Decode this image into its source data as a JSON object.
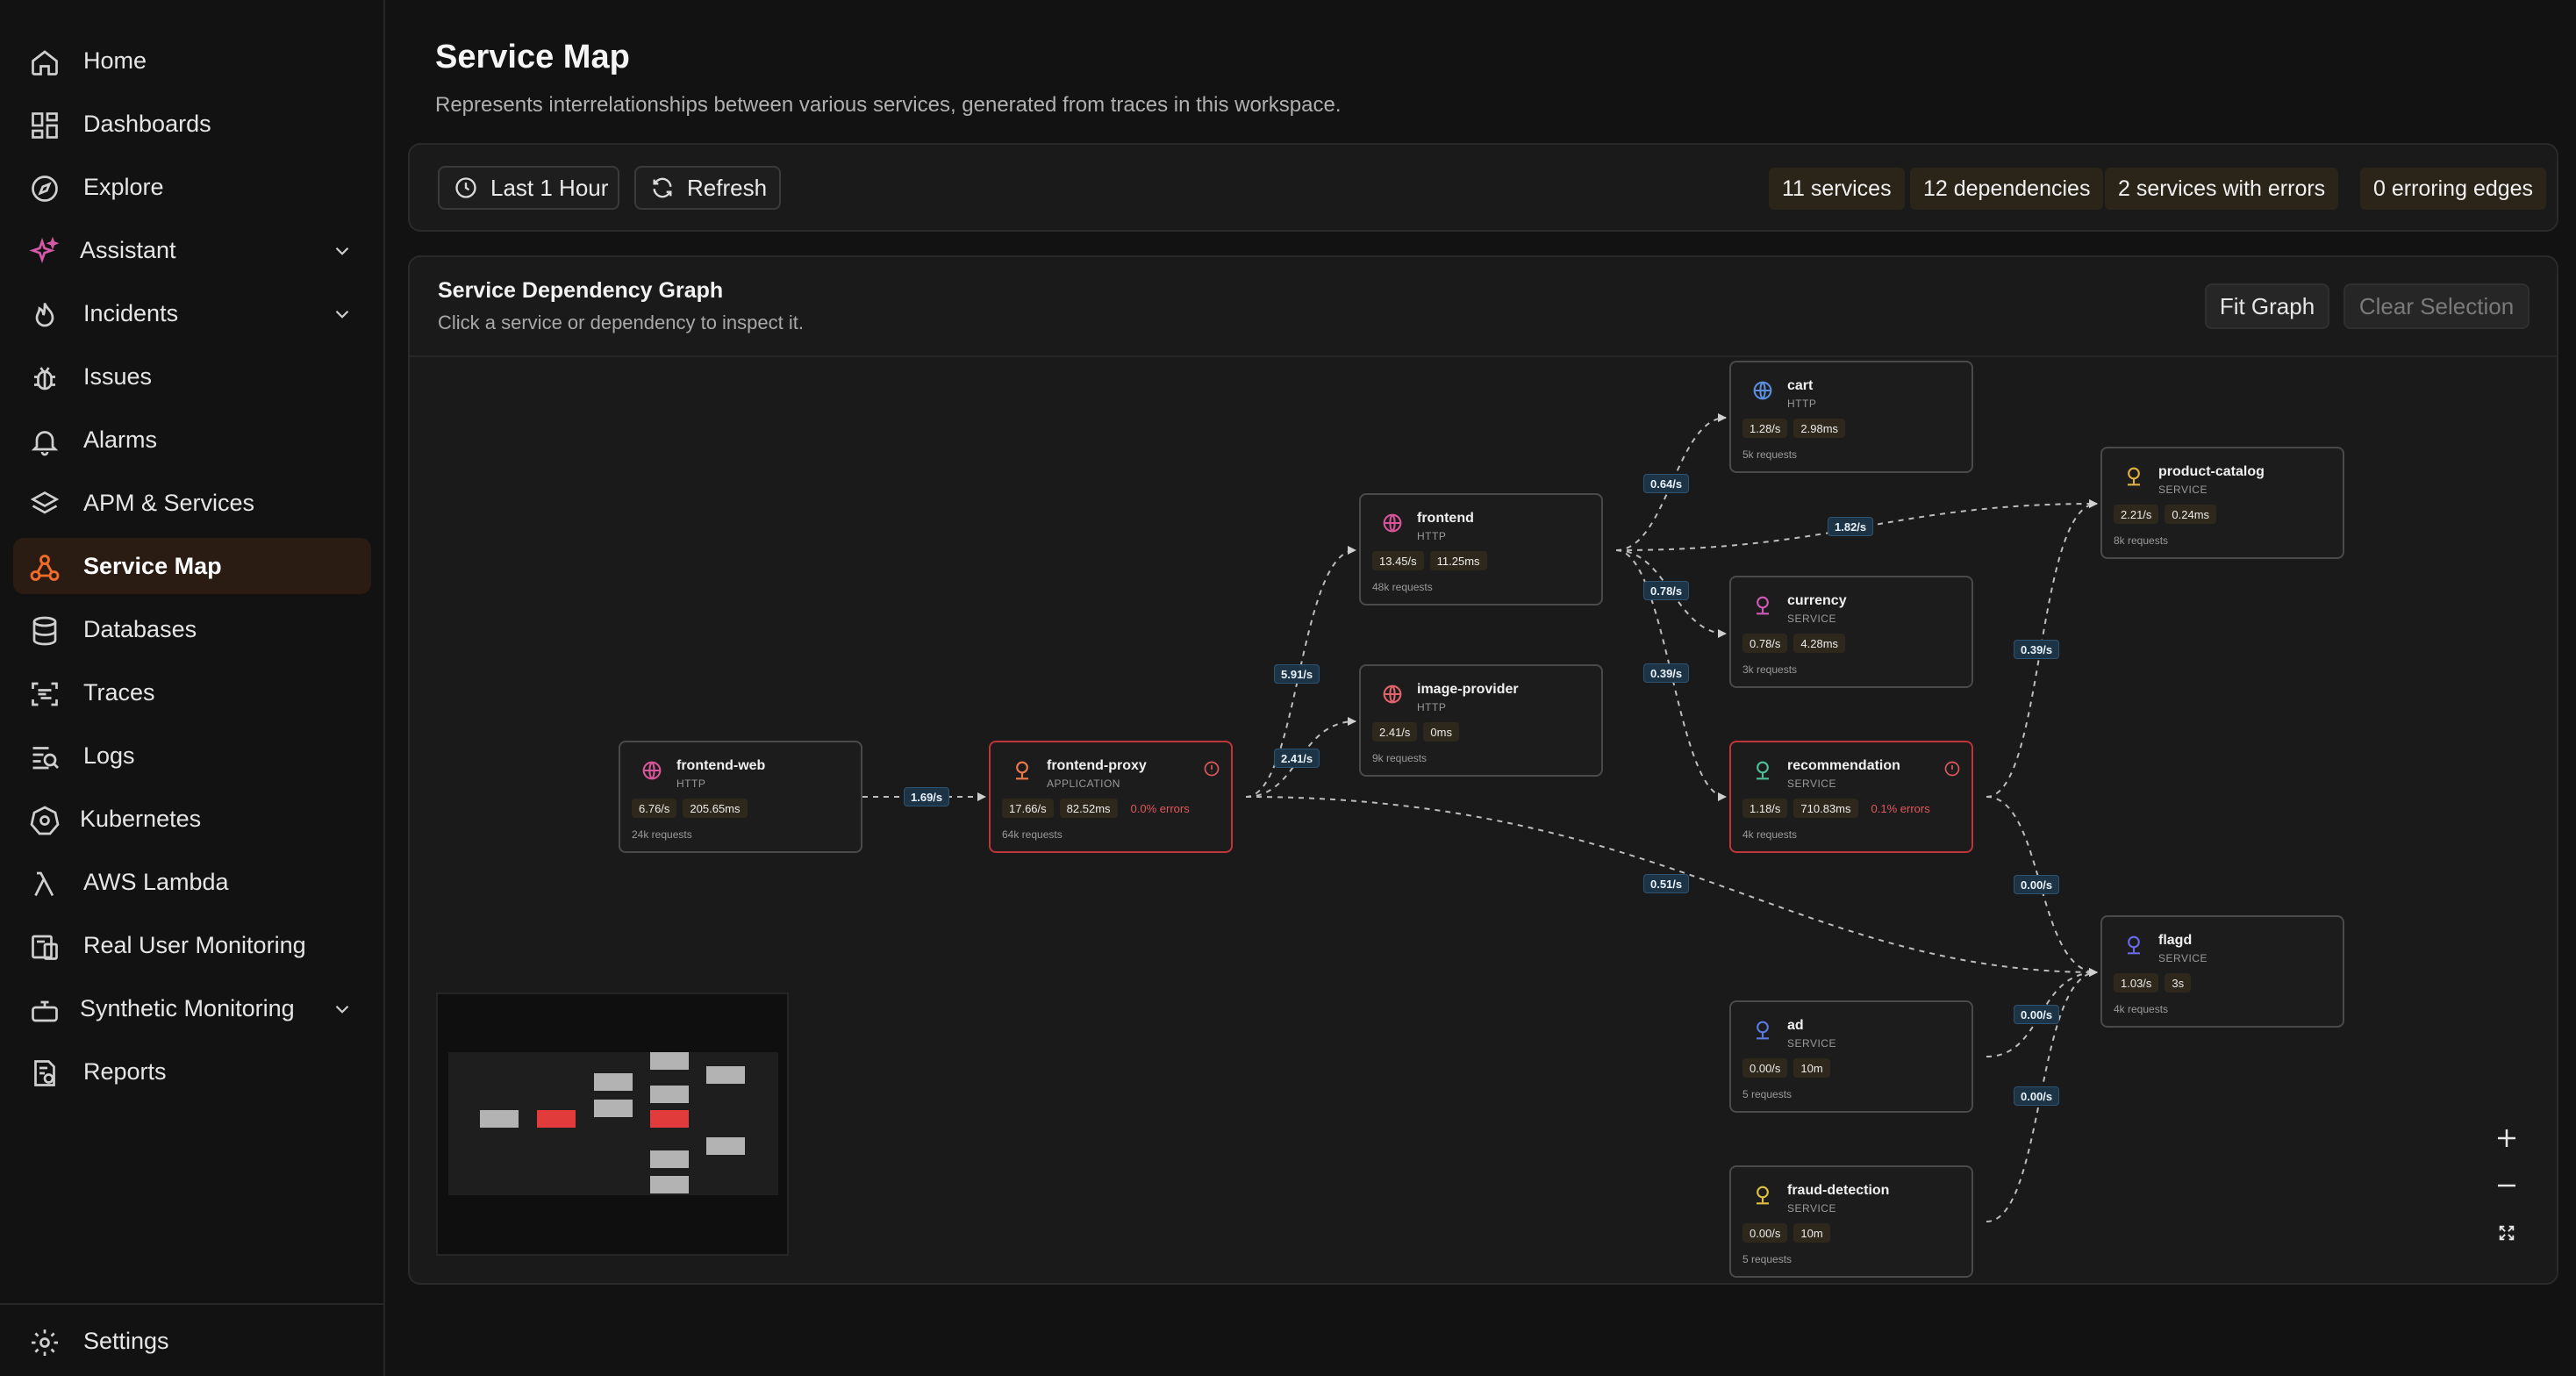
{
  "sidebar": {
    "items": [
      {
        "label": "Home",
        "icon": "home-icon"
      },
      {
        "label": "Dashboards",
        "icon": "dashboards-icon"
      },
      {
        "label": "Explore",
        "icon": "compass-icon"
      },
      {
        "label": "Assistant",
        "icon": "sparkle-icon"
      },
      {
        "label": "Incidents",
        "icon": "flame-icon"
      },
      {
        "label": "Issues",
        "icon": "bug-icon"
      },
      {
        "label": "Alarms",
        "icon": "bell-icon"
      },
      {
        "label": "APM & Services",
        "icon": "layers-icon"
      },
      {
        "label": "Service Map",
        "icon": "service-map-icon"
      },
      {
        "label": "Databases",
        "icon": "database-icon"
      },
      {
        "label": "Traces",
        "icon": "traces-icon"
      },
      {
        "label": "Logs",
        "icon": "logs-icon"
      },
      {
        "label": "Kubernetes",
        "icon": "kubernetes-icon"
      },
      {
        "label": "AWS Lambda",
        "icon": "lambda-icon"
      },
      {
        "label": "Real User Monitoring",
        "icon": "rum-icon"
      },
      {
        "label": "Synthetic Monitoring",
        "icon": "robot-icon"
      },
      {
        "label": "Reports",
        "icon": "reports-icon"
      }
    ],
    "active": "Service Map",
    "settings_label": "Settings"
  },
  "header": {
    "title": "Service Map",
    "subtitle": "Represents interrelationships between various services, generated from traces in this workspace."
  },
  "toolbar": {
    "time_range": "Last 1 Hour",
    "refresh": "Refresh",
    "stats": [
      "11 services",
      "12 dependencies",
      "2 services with errors",
      "0 erroring edges"
    ]
  },
  "graph": {
    "title": "Service Dependency Graph",
    "subtitle": "Click a service or dependency to inspect it.",
    "fit_label": "Fit Graph",
    "clear_label": "Clear Selection"
  },
  "nodes": {
    "frontend_web": {
      "name": "frontend-web",
      "type": "HTTP",
      "rate": "6.76/s",
      "latency": "205.65ms",
      "requests": "24k requests"
    },
    "frontend_proxy": {
      "name": "frontend-proxy",
      "type": "APPLICATION",
      "rate": "17.66/s",
      "latency": "82.52ms",
      "errors": "0.0% errors",
      "requests": "64k requests"
    },
    "frontend": {
      "name": "frontend",
      "type": "HTTP",
      "rate": "13.45/s",
      "latency": "11.25ms",
      "requests": "48k requests"
    },
    "image_provider": {
      "name": "image-provider",
      "type": "HTTP",
      "rate": "2.41/s",
      "latency": "0ms",
      "requests": "9k requests"
    },
    "cart": {
      "name": "cart",
      "type": "HTTP",
      "rate": "1.28/s",
      "latency": "2.98ms",
      "requests": "5k requests"
    },
    "currency": {
      "name": "currency",
      "type": "SERVICE",
      "rate": "0.78/s",
      "latency": "4.28ms",
      "requests": "3k requests"
    },
    "recommendation": {
      "name": "recommendation",
      "type": "SERVICE",
      "rate": "1.18/s",
      "latency": "710.83ms",
      "errors": "0.1% errors",
      "requests": "4k requests"
    },
    "ad": {
      "name": "ad",
      "type": "SERVICE",
      "rate": "0.00/s",
      "latency": "10m",
      "requests": "5 requests"
    },
    "fraud_detection": {
      "name": "fraud-detection",
      "type": "SERVICE",
      "rate": "0.00/s",
      "latency": "10m",
      "requests": "5 requests"
    },
    "product_catalog": {
      "name": "product-catalog",
      "type": "SERVICE",
      "rate": "2.21/s",
      "latency": "0.24ms",
      "requests": "8k requests"
    },
    "flagd": {
      "name": "flagd",
      "type": "SERVICE",
      "rate": "1.03/s",
      "latency": "3s",
      "requests": "4k requests"
    }
  },
  "edges": {
    "web_proxy": "1.69/s",
    "proxy_frontend": "5.91/s",
    "proxy_image": "2.41/s",
    "proxy_flagd": "0.51/s",
    "frontend_cart": "0.64/s",
    "frontend_catalog": "1.82/s",
    "frontend_currency": "0.78/s",
    "frontend_recommendation": "0.39/s",
    "recommendation_catalog": "0.39/s",
    "recommendation_flagd": "0.00/s",
    "ad_flagd": "0.00/s",
    "fraud_flagd": "0.00/s"
  },
  "colors": {
    "accent": "#f26b2a",
    "error": "#c0343a",
    "edge_label_bg": "#1d3447"
  }
}
